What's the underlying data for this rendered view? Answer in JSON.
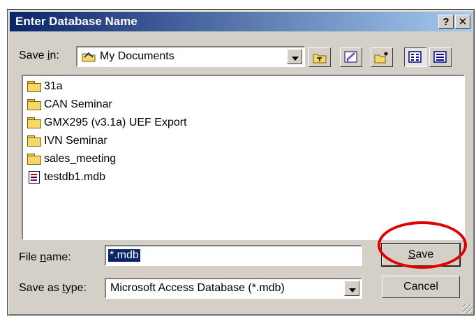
{
  "window": {
    "title": "Enter Database Name",
    "help_glyph": "?",
    "close_glyph": "✕"
  },
  "save_in": {
    "label_pre": "Save ",
    "label_accel": "i",
    "label_post": "n:",
    "value": "My Documents"
  },
  "toolbar": {
    "icons": [
      "up-one-level-icon",
      "desktop-icon",
      "new-folder-icon",
      "list-view-icon",
      "details-view-icon"
    ]
  },
  "files": [
    {
      "name": "31a",
      "type": "folder"
    },
    {
      "name": "CAN Seminar",
      "type": "folder"
    },
    {
      "name": "GMX295 (v3.1a) UEF Export",
      "type": "folder"
    },
    {
      "name": "IVN Seminar",
      "type": "folder"
    },
    {
      "name": "sales_meeting",
      "type": "folder"
    },
    {
      "name": "testdb1.mdb",
      "type": "mdb"
    }
  ],
  "file_name": {
    "label_pre": "File ",
    "label_accel": "n",
    "label_post": "ame:",
    "value": "*.mdb"
  },
  "save_as_type": {
    "label_pre": "Save as ",
    "label_accel": "t",
    "label_post": "ype:",
    "value": "Microsoft Access Database (*.mdb)"
  },
  "buttons": {
    "save_accel": "S",
    "save_rest": "ave",
    "cancel": "Cancel"
  },
  "colors": {
    "titlebar": "#0a246a",
    "highlight_circle": "#e00000",
    "dialog_face": "#d4d0c8"
  }
}
